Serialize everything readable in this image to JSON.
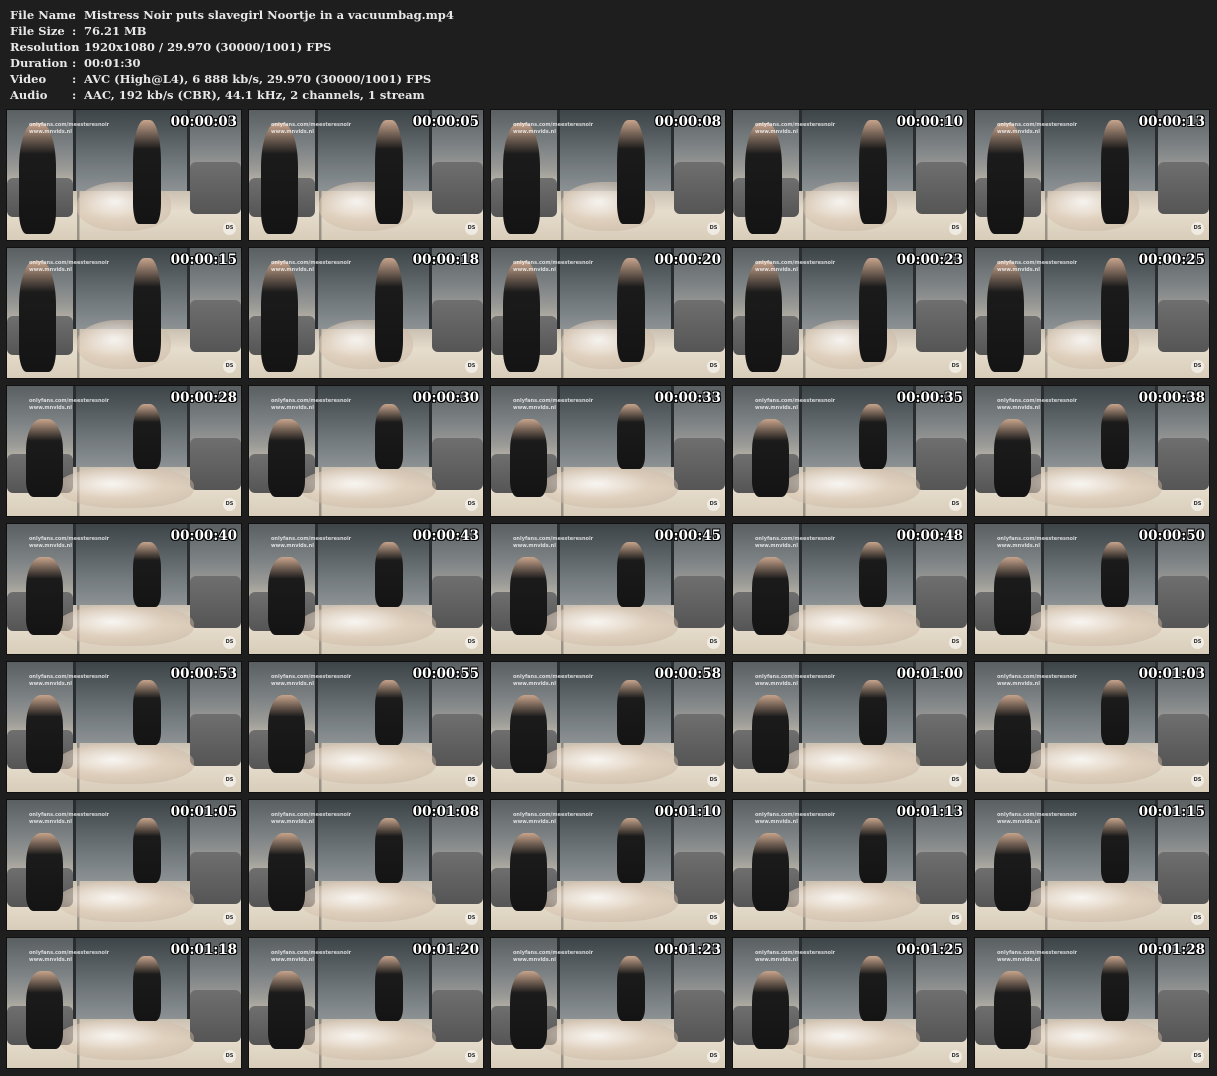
{
  "info": [
    {
      "key": "File Name",
      "value": "Mistress Noir puts slavegirl Noortje in a vacuumbag.mp4"
    },
    {
      "key": "File Size",
      "value": "76.21 MB"
    },
    {
      "key": "Resolution",
      "value": "1920x1080 / 29.970 (30000/1001) FPS"
    },
    {
      "key": "Duration",
      "value": "00:01:30"
    },
    {
      "key": "Video",
      "value": "AVC (High@L4), 6 888 kb/s, 29.970 (30000/1001) FPS"
    },
    {
      "key": "Audio",
      "value": "AAC, 192 kb/s (CBR), 44.1 kHz, 2 channels, 1 stream"
    }
  ],
  "separator": ":",
  "watermark_line1": "onlyfans.com/meesteresnoir",
  "watermark_line2": "www.mnvids.nl",
  "logo_text": "DS",
  "thumbnails": [
    "00:00:03",
    "00:00:05",
    "00:00:08",
    "00:00:10",
    "00:00:13",
    "00:00:15",
    "00:00:18",
    "00:00:20",
    "00:00:23",
    "00:00:25",
    "00:00:28",
    "00:00:30",
    "00:00:33",
    "00:00:35",
    "00:00:38",
    "00:00:40",
    "00:00:43",
    "00:00:45",
    "00:00:48",
    "00:00:50",
    "00:00:53",
    "00:00:55",
    "00:00:58",
    "00:01:00",
    "00:01:03",
    "00:01:05",
    "00:01:08",
    "00:01:10",
    "00:01:13",
    "00:01:15",
    "00:01:18",
    "00:01:20",
    "00:01:23",
    "00:01:25",
    "00:01:28"
  ]
}
